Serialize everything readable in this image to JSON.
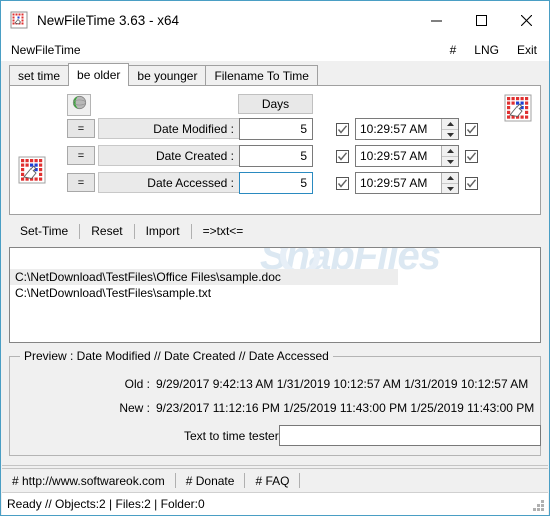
{
  "window": {
    "title": "NewFileTime 3.63 - x64",
    "app_icon": "newfiletime-app-icon",
    "minimize": "─",
    "maximize": "☐",
    "close": "✕"
  },
  "menu": {
    "left_label": "NewFileTime",
    "right_items": [
      {
        "label": "#",
        "name": "hash"
      },
      {
        "label": "LNG",
        "name": "language"
      },
      {
        "label": "Exit",
        "name": "exit"
      }
    ]
  },
  "tabs": [
    {
      "label": "set time",
      "active": false
    },
    {
      "label": "be older",
      "active": true
    },
    {
      "label": "be younger",
      "active": false
    },
    {
      "label": "Filename To Time",
      "active": false
    }
  ],
  "panel": {
    "globe_icon": "globe-icon",
    "days_header": "Days",
    "calendar_icon_top_right": "calendar-hand-icon",
    "calendar_icon_bottom_left": "calendar-hand-icon",
    "rows": [
      {
        "eq_label": "=",
        "label": "Date Modified :",
        "days_value": "5",
        "days_focused": false,
        "days_checkbox_checked": true,
        "time_value": "10:29:57 AM",
        "time_checkbox_checked": true
      },
      {
        "eq_label": "=",
        "label": "Date Created :",
        "days_value": "5",
        "days_focused": false,
        "days_checkbox_checked": true,
        "time_value": "10:29:57 AM",
        "time_checkbox_checked": true
      },
      {
        "eq_label": "=",
        "label": "Date Accessed :",
        "days_value": "5",
        "days_focused": true,
        "days_checkbox_checked": true,
        "time_value": "10:29:57 AM",
        "time_checkbox_checked": true
      }
    ]
  },
  "actions": [
    {
      "label": "Set-Time"
    },
    {
      "label": "Reset"
    },
    {
      "label": "Import"
    },
    {
      "label": "=>txt<="
    }
  ],
  "filelist": {
    "watermark": "SnapFiles",
    "files": [
      {
        "path": "C:\\NetDownload\\TestFiles\\Office Files\\sample.doc",
        "selected": true
      },
      {
        "path": "C:\\NetDownload\\TestFiles\\sample.txt",
        "selected": false
      }
    ]
  },
  "preview": {
    "title": "Preview :   Date Modified    //    Date Created    //    Date Accessed",
    "old_label": "Old :",
    "new_label": "New :",
    "old_values": "9/29/2017 9:42:13 AM   1/31/2019 10:12:57 AM  1/31/2019 10:12:57 AM",
    "new_values": "9/23/2017 11:12:16 PM  1/25/2019 11:43:00 PM  1/25/2019 11:43:00 PM"
  },
  "tester": {
    "label": "Text to time tester",
    "value": "",
    "placeholder": ""
  },
  "links": [
    {
      "label": "# http://www.softwareok.com"
    },
    {
      "label": "# Donate"
    },
    {
      "label": "# FAQ"
    }
  ],
  "status": {
    "text": "Ready // Objects:2 | Files:2  | Folder:0"
  },
  "colors": {
    "window_border": "#4a9ec4",
    "focus_border": "#2a8ac0",
    "panel_bg": "#f0f0f0",
    "selection": "#ededed",
    "icon_red": "#e03030",
    "icon_blue": "#2040d0",
    "icon_green": "#3aa83a"
  }
}
